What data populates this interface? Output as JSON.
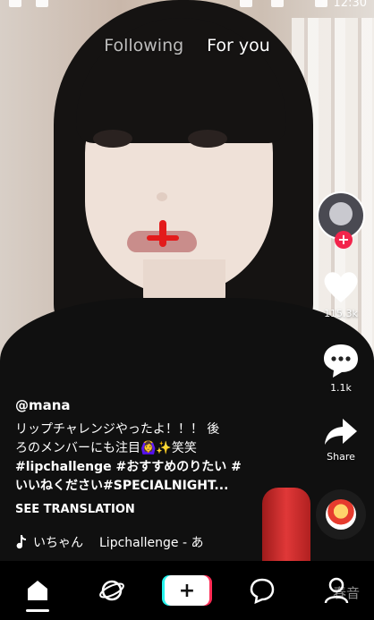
{
  "status_bar": {
    "time": "12:30"
  },
  "top_tabs": {
    "following": "Following",
    "for_you": "For you"
  },
  "actions": {
    "likes": "115.3k",
    "comments": "1.1k",
    "share": "Share"
  },
  "caption": {
    "username": "@mana",
    "line1": "リップチャレンジやったよ！！！ 後",
    "line2": "ろのメンバーにも注目🙆‍♀️✨笑笑",
    "line3": "#lipchallenge #おすすめのりたい #",
    "line4": "いいねください#SPECIALNIGHT...",
    "see_translation": "SEE TRANSLATION"
  },
  "music": {
    "artist": "いちゃん",
    "track": "Lipchallenge - あ"
  },
  "bottom_nav": {
    "watermark": "春音"
  },
  "colors": {
    "accent_red": "#f2244b",
    "accent_cyan": "#25f4ee",
    "accent_pink": "#fe2c55"
  }
}
